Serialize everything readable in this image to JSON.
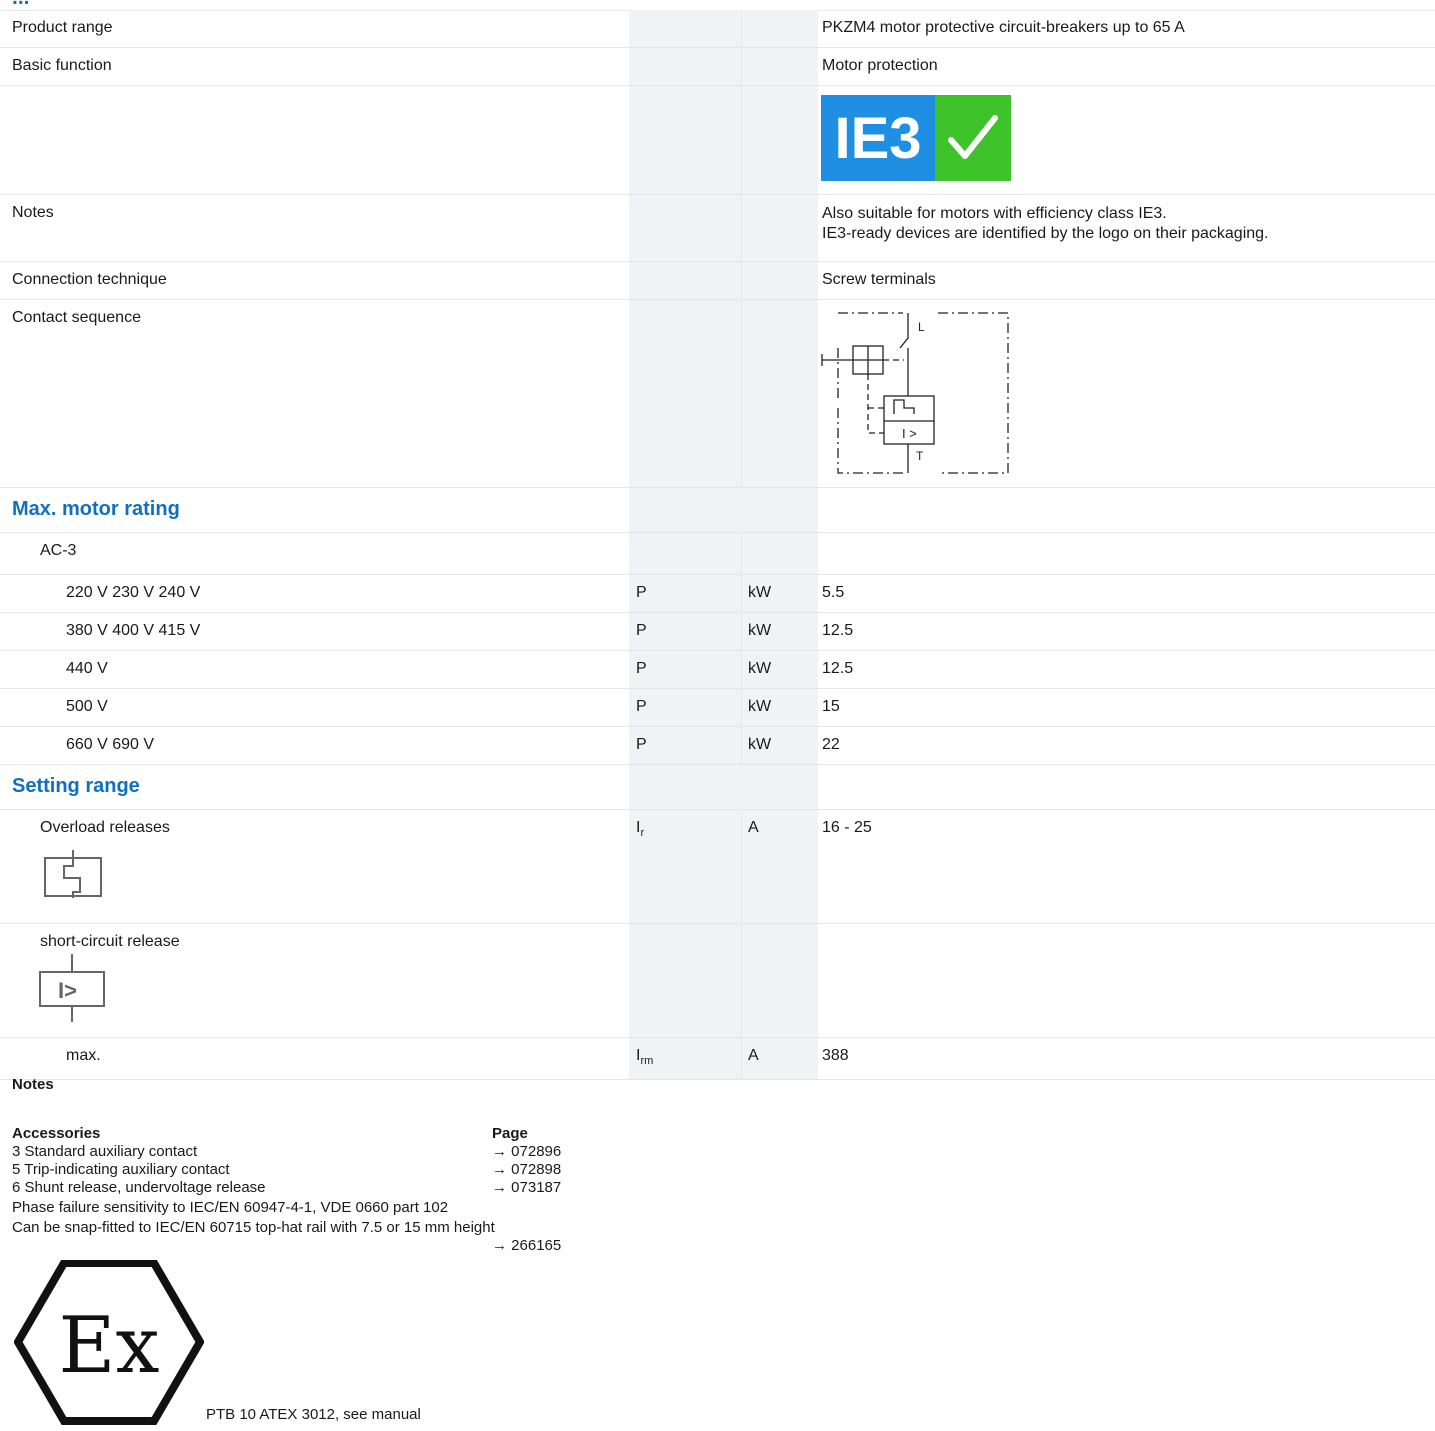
{
  "header": {
    "title_fragment": "..."
  },
  "rows": {
    "product_range": {
      "label": "Product range",
      "value": "PKZM4 motor protective circuit-breakers up to 65 A"
    },
    "basic_function": {
      "label": "Basic function",
      "value": "Motor protection"
    },
    "logo": {
      "text": "IE3"
    },
    "notes": {
      "label": "Notes",
      "line1": "Also suitable for motors with efficiency class IE3.",
      "line2": "IE3-ready devices are identified by the logo on their packaging."
    },
    "connection": {
      "label": "Connection technique",
      "value": "Screw terminals"
    },
    "contact_sequence": {
      "label": "Contact sequence",
      "diagram_L": "L",
      "diagram_T": "T",
      "diagram_I": "I >"
    }
  },
  "max_motor_rating": {
    "title": "Max. motor rating",
    "category": "AC-3",
    "rows": [
      {
        "label": "220 V 230 V 240 V",
        "symbol": "P",
        "unit": "kW",
        "value": "5.5"
      },
      {
        "label": "380 V 400 V 415 V",
        "symbol": "P",
        "unit": "kW",
        "value": "12.5"
      },
      {
        "label": "440 V",
        "symbol": "P",
        "unit": "kW",
        "value": "12.5"
      },
      {
        "label": "500 V",
        "symbol": "P",
        "unit": "kW",
        "value": "15"
      },
      {
        "label": "660 V 690 V",
        "symbol": "P",
        "unit": "kW",
        "value": "22"
      }
    ]
  },
  "setting_range": {
    "title": "Setting range",
    "overload": {
      "label": "Overload releases",
      "symbol": "I",
      "symbol_sub": "r",
      "unit": "A",
      "value": "16 - 25"
    },
    "short_circuit": {
      "label": "short-circuit release",
      "icon_text": "I>"
    },
    "max": {
      "label": "max.",
      "symbol": "I",
      "symbol_sub": "rm",
      "unit": "A",
      "value": "388"
    }
  },
  "footer": {
    "notes_title": "Notes",
    "accessories_title": "Accessories",
    "page_title": "Page",
    "accessories": [
      {
        "label": "3 Standard auxiliary contact",
        "page": "072896"
      },
      {
        "label": "5 Trip-indicating auxiliary contact",
        "page": "072898"
      },
      {
        "label": "6 Shunt release, undervoltage release",
        "page": "073187"
      }
    ],
    "line_phase": "Phase failure sensitivity to IEC/EN 60947-4-1, VDE 0660 part 102",
    "line_rail": "Can be snap-fitted to IEC/EN 60715 top-hat rail with 7.5 or 15 mm height",
    "rail_page": "266165",
    "arrow": "→",
    "atex": "PTB 10 ATEX 3012, see manual",
    "ex_text": "Ex"
  }
}
